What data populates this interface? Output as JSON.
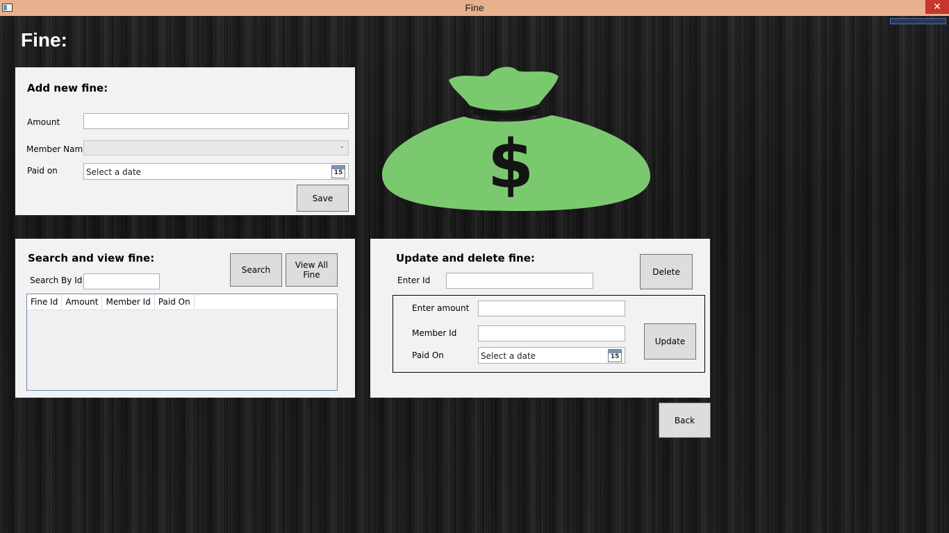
{
  "window": {
    "title": "Fine",
    "close_glyph": "✕"
  },
  "page": {
    "heading": "Fine:"
  },
  "add_panel": {
    "heading": "Add new fine:",
    "amount_label": "Amount",
    "amount_value": "",
    "member_name_label": "Member Name",
    "member_name_value": "",
    "paid_on_label": "Paid on",
    "paid_on_placeholder": "Select a date",
    "save_label": "Save"
  },
  "search_panel": {
    "heading": "Search and view fine:",
    "search_by_id_label": "Search By Id:",
    "search_value": "",
    "search_button": "Search",
    "view_all_button": "View All Fine",
    "columns": [
      "Fine Id",
      "Amount",
      "Member Id",
      "Paid On"
    ]
  },
  "update_panel": {
    "heading": "Update and delete fine:",
    "enter_id_label": "Enter Id",
    "enter_id_value": "",
    "delete_button": "Delete",
    "enter_amount_label": "Enter amount",
    "enter_amount_value": "",
    "member_id_label": "Member Id",
    "member_id_value": "",
    "paid_on_label": "Paid On",
    "paid_on_placeholder": "Select a date",
    "update_button": "Update"
  },
  "back_button": "Back",
  "calendar_icon_day": "15",
  "colors": {
    "titlebar": "#e8b08d",
    "close": "#c7352b",
    "bag_green": "#7bc96f",
    "panel_bg": "#f2f2f2"
  },
  "icons": {
    "app": "window-app-icon",
    "calendar": "calendar-icon",
    "combo": "chevron-down-icon",
    "illustration": "money-bag-icon"
  }
}
